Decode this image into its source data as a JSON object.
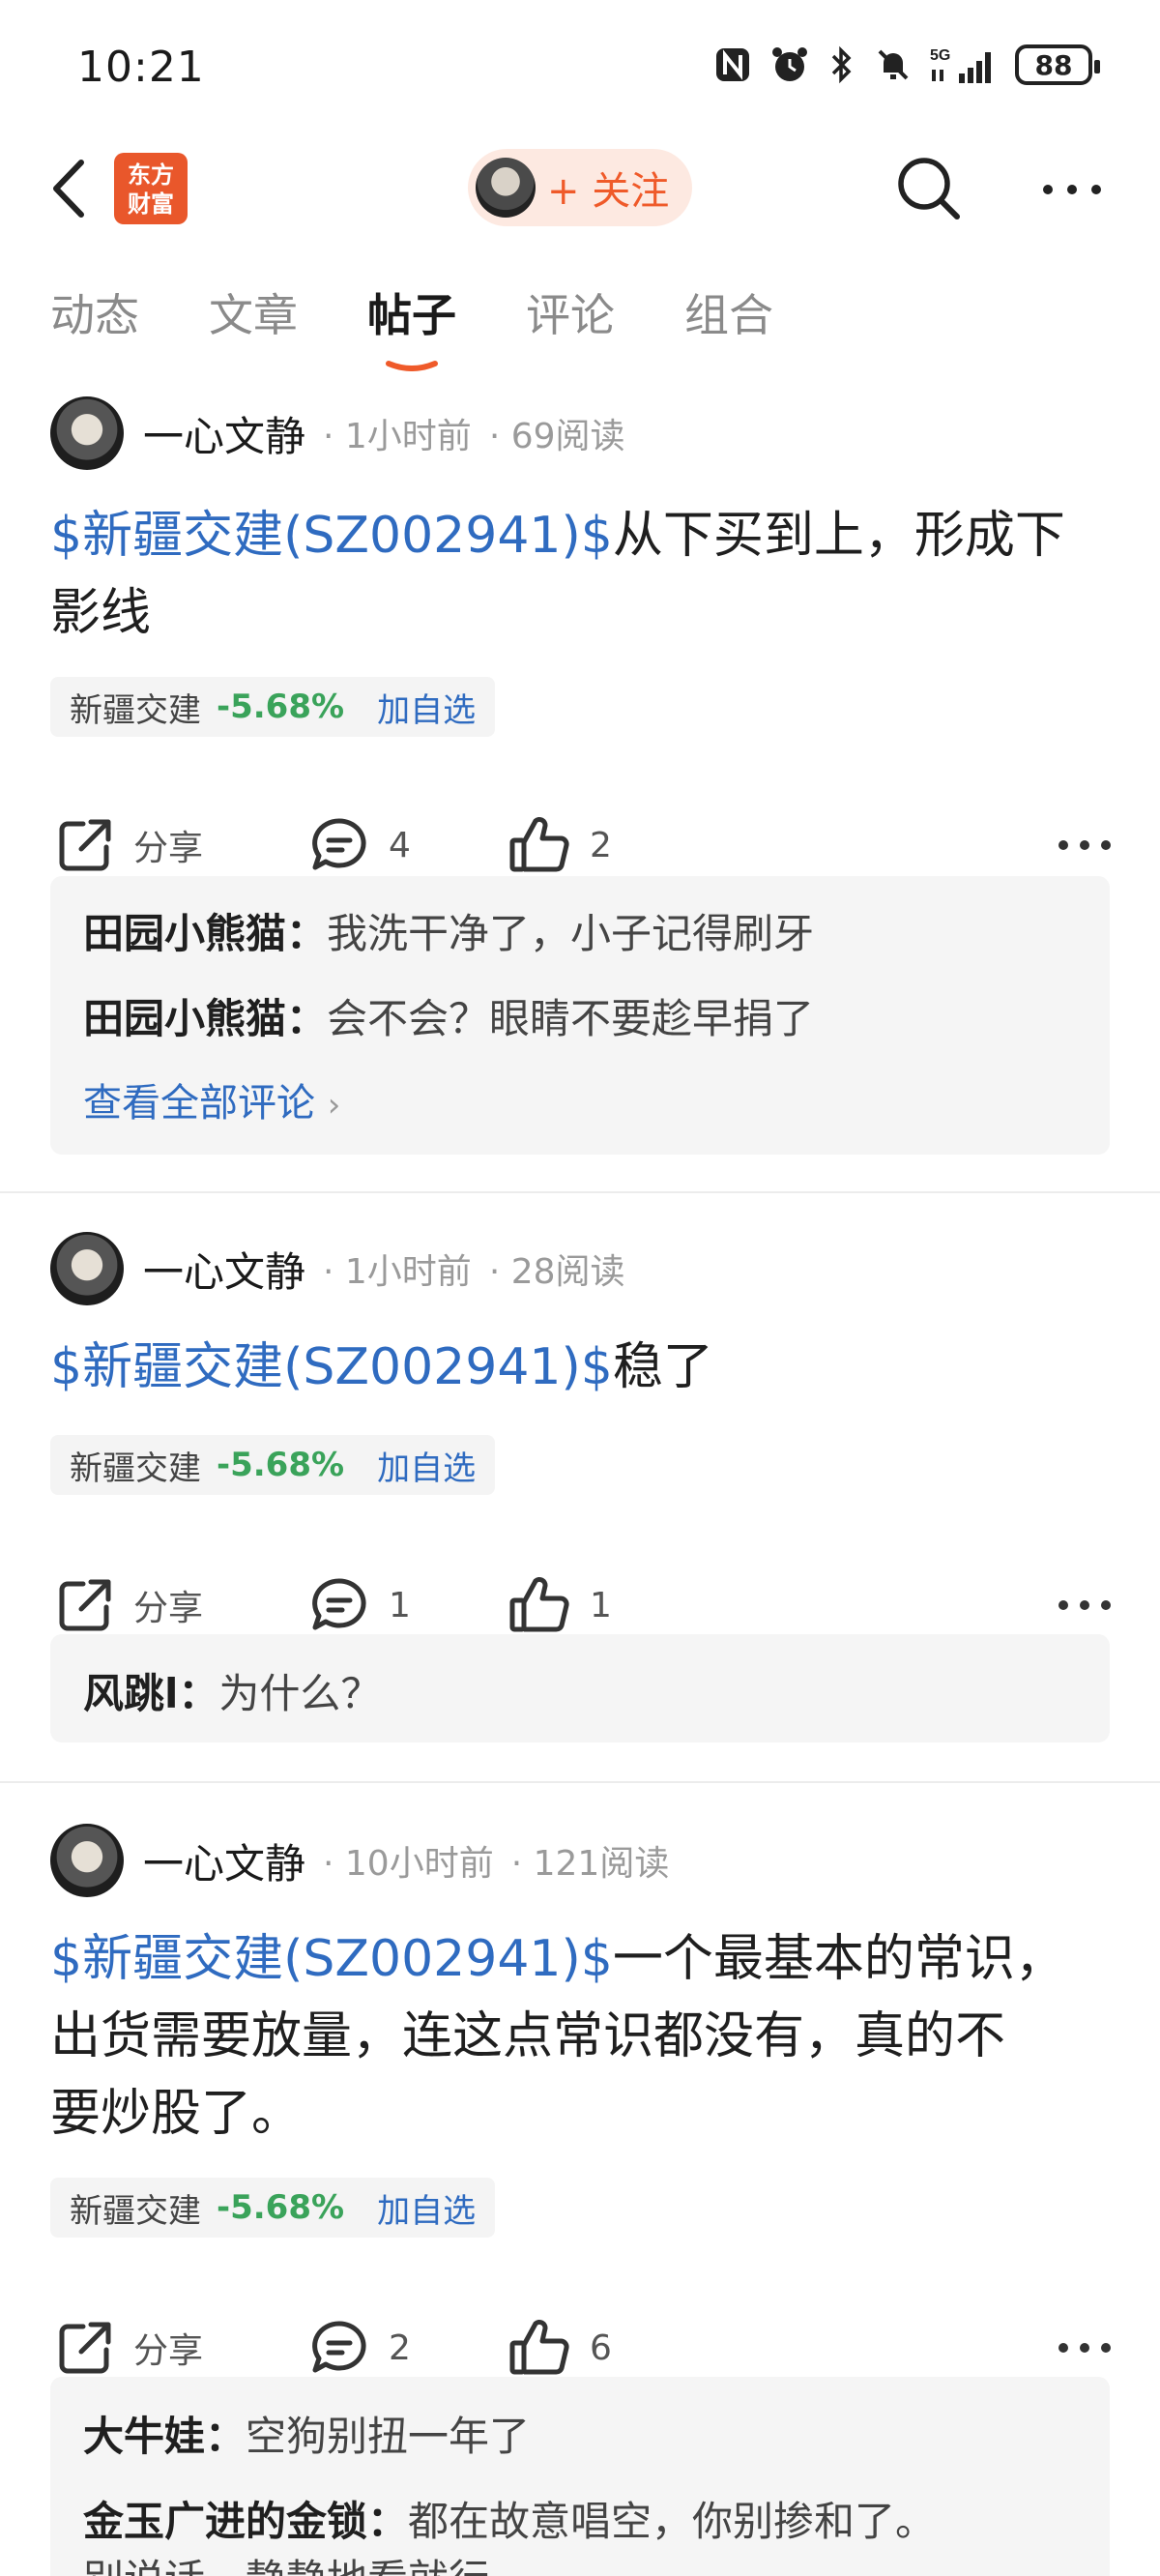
{
  "status_bar": {
    "time": "10:21",
    "battery": "88",
    "network": "5G"
  },
  "header": {
    "logo_line1": "东方",
    "logo_line2": "财富",
    "follow_label": "+ 关注"
  },
  "tabs": [
    {
      "label": "动态"
    },
    {
      "label": "文章"
    },
    {
      "label": "帖子",
      "active": true
    },
    {
      "label": "评论"
    },
    {
      "label": "组合"
    }
  ],
  "posts": [
    {
      "author": "一心文静",
      "time": "1小时前",
      "reads": "69阅读",
      "tag": "$新疆交建(SZ002941)$",
      "text_line1": "从下买到上，形成下",
      "text_line2": "影线",
      "stock": {
        "name": "新疆交建",
        "change": "-5.68%",
        "add": "加自选"
      },
      "share_label": "分享",
      "comment_count": "4",
      "like_count": "2",
      "comments": [
        {
          "user": "田园小熊猫",
          "text": "我洗干净了，小子记得刷牙"
        },
        {
          "user": "田园小熊猫",
          "text": "会不会？眼睛不要趁早捐了"
        }
      ],
      "view_all": "查看全部评论"
    },
    {
      "author": "一心文静",
      "time": "1小时前",
      "reads": "28阅读",
      "tag": "$新疆交建(SZ002941)$",
      "text_line1": "稳了",
      "stock": {
        "name": "新疆交建",
        "change": "-5.68%",
        "add": "加自选"
      },
      "share_label": "分享",
      "comment_count": "1",
      "like_count": "1",
      "comments": [
        {
          "user": "风跳l",
          "text": "为什么？"
        }
      ]
    },
    {
      "author": "一心文静",
      "time": "10小时前",
      "reads": "121阅读",
      "tag": "$新疆交建(SZ002941)$",
      "text_line1": "一个最基本的常识，",
      "text_line2": "出货需要放量，连这点常识都没有，真的不",
      "text_line3": "要炒股了。",
      "stock": {
        "name": "新疆交建",
        "change": "-5.68%",
        "add": "加自选"
      },
      "share_label": "分享",
      "comment_count": "2",
      "like_count": "6",
      "comments": [
        {
          "user": "大牛娃",
          "text": "空狗别扭一年了"
        },
        {
          "user": "金玉广进的金锁",
          "text": "都在故意唱空，你别掺和了。"
        },
        {
          "text": "别说话，静静地看就行。"
        }
      ]
    }
  ],
  "colors": {
    "accent": "#ef5a2a",
    "link": "#2f6bc0",
    "down": "#3aa35a"
  }
}
